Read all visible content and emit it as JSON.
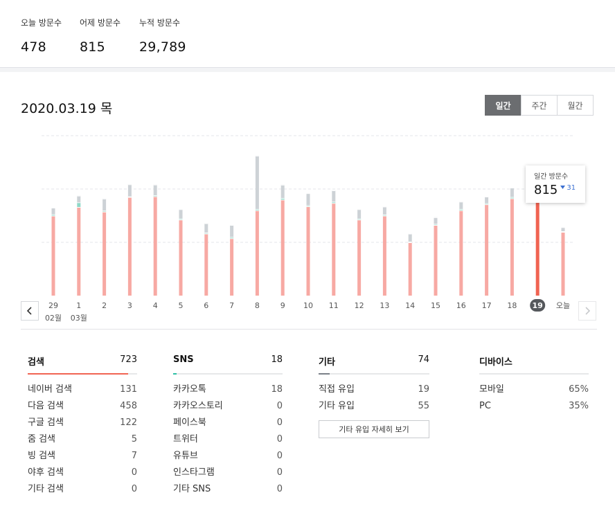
{
  "summary": {
    "today_label": "오늘 방문수",
    "today_value": "478",
    "yesterday_label": "어제 방문수",
    "yesterday_value": "815",
    "total_label": "누적 방문수",
    "total_value": "29,789"
  },
  "date_title": "2020.03.19 목",
  "period_tabs": [
    "일간",
    "주간",
    "월간"
  ],
  "tooltip": {
    "label": "일간 방문수",
    "value": "815",
    "delta": "31"
  },
  "chart_data": {
    "type": "bar",
    "categories": [
      "29",
      "1",
      "2",
      "3",
      "4",
      "5",
      "6",
      "7",
      "8",
      "9",
      "10",
      "11",
      "12",
      "13",
      "14",
      "15",
      "16",
      "17",
      "18",
      "19",
      "오늘"
    ],
    "month_labels": [
      {
        "index": 0,
        "text": "02월"
      },
      {
        "index": 1,
        "text": "03월"
      }
    ],
    "highlight_index": 19,
    "series": [
      {
        "values": [
          600,
          665,
          630,
          740,
          745,
          570,
          465,
          430,
          640,
          720,
          670,
          695,
          570,
          600,
          400,
          530,
          640,
          685,
          730,
          815,
          478
        ]
      },
      {
        "values": [
          10,
          35,
          8,
          5,
          8,
          8,
          8,
          10,
          10,
          12,
          8,
          10,
          8,
          8,
          5,
          8,
          10,
          8,
          10,
          18,
          5
        ]
      },
      {
        "values": [
          50,
          50,
          90,
          90,
          80,
          70,
          70,
          90,
          400,
          100,
          90,
          85,
          70,
          60,
          60,
          50,
          55,
          50,
          70,
          31,
          30
        ]
      }
    ],
    "colors": {
      "series_0": "#f7a9a3",
      "series_0_highlight": "#f06352",
      "series_1": "#8fd8c8",
      "series_2": "#cdd2d6",
      "series_2_highlight": "#7a8087"
    },
    "ylim": [
      0,
      1200
    ],
    "grid": true
  },
  "panels": {
    "search": {
      "title": "검색",
      "count": "723",
      "color": "#f06352",
      "fill": 0.92,
      "rows": [
        [
          "네이버 검색",
          "131"
        ],
        [
          "다음 검색",
          "458"
        ],
        [
          "구글 검색",
          "122"
        ],
        [
          "줌 검색",
          "5"
        ],
        [
          "빙 검색",
          "7"
        ],
        [
          "야후 검색",
          "0"
        ],
        [
          "기타 검색",
          "0"
        ]
      ]
    },
    "sns": {
      "title": "SNS",
      "count": "18",
      "color": "#2bbfa4",
      "fill": 0.03,
      "rows": [
        [
          "카카오톡",
          "18"
        ],
        [
          "카카오스토리",
          "0"
        ],
        [
          "페이스북",
          "0"
        ],
        [
          "트위터",
          "0"
        ],
        [
          "유튜브",
          "0"
        ],
        [
          "인스타그램",
          "0"
        ],
        [
          "기타 SNS",
          "0"
        ]
      ]
    },
    "etc": {
      "title": "기타",
      "count": "74",
      "color": "#7a8087",
      "fill": 0.1,
      "rows": [
        [
          "직접 유입",
          "19"
        ],
        [
          "기타 유입",
          "55"
        ]
      ],
      "button": "기타 유입 자세히 보기"
    },
    "device": {
      "title": "디바이스",
      "rows": [
        [
          "모바일",
          "65%"
        ],
        [
          "PC",
          "35%"
        ]
      ]
    }
  },
  "icons": {
    "prev": "chevron-left-icon",
    "next": "chevron-right-icon",
    "delta": "triangle-down-icon"
  }
}
